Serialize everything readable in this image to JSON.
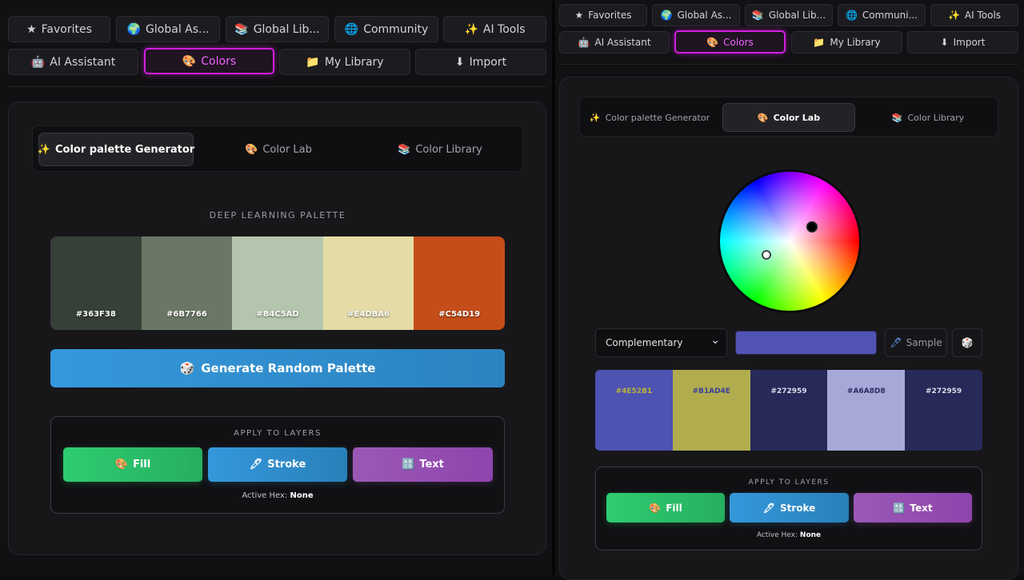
{
  "nav": {
    "favorites": {
      "icon": "★",
      "label": "Favorites"
    },
    "global_assets": {
      "icon": "🌍",
      "label": "Global As..."
    },
    "global_library": {
      "icon": "📚",
      "label": "Global Lib..."
    },
    "community": {
      "icon": "🌐",
      "label": "Community"
    },
    "ai_tools": {
      "icon": "✨",
      "label": "AI Tools"
    },
    "ai_assistant": {
      "icon": "🤖",
      "label": "AI Assistant"
    },
    "colors": {
      "icon": "🎨",
      "label": "Colors"
    },
    "my_library": {
      "icon": "📁",
      "label": "My Library"
    },
    "import": {
      "icon": "⬇",
      "label": "Import"
    }
  },
  "nav_right": {
    "global_assets": "Global As...",
    "global_library": "Global Lib...",
    "community": "Communi..."
  },
  "tabs": {
    "generator": {
      "icon": "✨",
      "label": "Color palette Generator"
    },
    "lab": {
      "icon": "🎨",
      "label": "Color Lab"
    },
    "library": {
      "icon": "📚",
      "label": "Color Library"
    }
  },
  "generator": {
    "palette_name": "DEEP LEARNING PALETTE",
    "swatches": [
      {
        "hex": "#363F38",
        "color": "#363F38",
        "text_color": "#ffffff"
      },
      {
        "hex": "#6B7766",
        "color": "#6B7766",
        "text_color": "#ffffff"
      },
      {
        "hex": "#B4C5AD",
        "color": "#B4C5AD",
        "text_color": "#ffffff"
      },
      {
        "hex": "#E4DBA6",
        "color": "#E4DBA6",
        "text_color": "#ffffff"
      },
      {
        "hex": "#C54D19",
        "color": "#C54D19",
        "text_color": "#ffffff"
      }
    ],
    "generate_icon": "🎲",
    "generate_label": "Generate Random Palette"
  },
  "apply": {
    "title": "APPLY TO LAYERS",
    "fill_icon": "🎨",
    "fill_label": "Fill",
    "stroke_icon": "🖊",
    "stroke_label": "Stroke",
    "text_icon": "🔠",
    "text_label": "Text",
    "active_hex_label": "Active Hex:",
    "active_hex_value": "None"
  },
  "lab": {
    "harmony": "Complementary",
    "harmony_options": [
      "Complementary"
    ],
    "chevron": "⌄",
    "selected_color": "#5153B5",
    "sample_icon": "🖊",
    "sample_label": "Sample",
    "random_icon": "🎲",
    "swatches": [
      {
        "hex": "#4E52B1",
        "color": "#4E52B1",
        "text_color": "#b8b23c"
      },
      {
        "hex": "#B1AD4E",
        "color": "#B1AD4E",
        "text_color": "#3a3f9a"
      },
      {
        "hex": "#272959",
        "color": "#272959",
        "text_color": "#dcdcea"
      },
      {
        "hex": "#A6A8D8",
        "color": "#A6A8D8",
        "text_color": "#2a2c5e"
      },
      {
        "hex": "#272959",
        "color": "#272959",
        "text_color": "#dcdcea"
      }
    ]
  }
}
